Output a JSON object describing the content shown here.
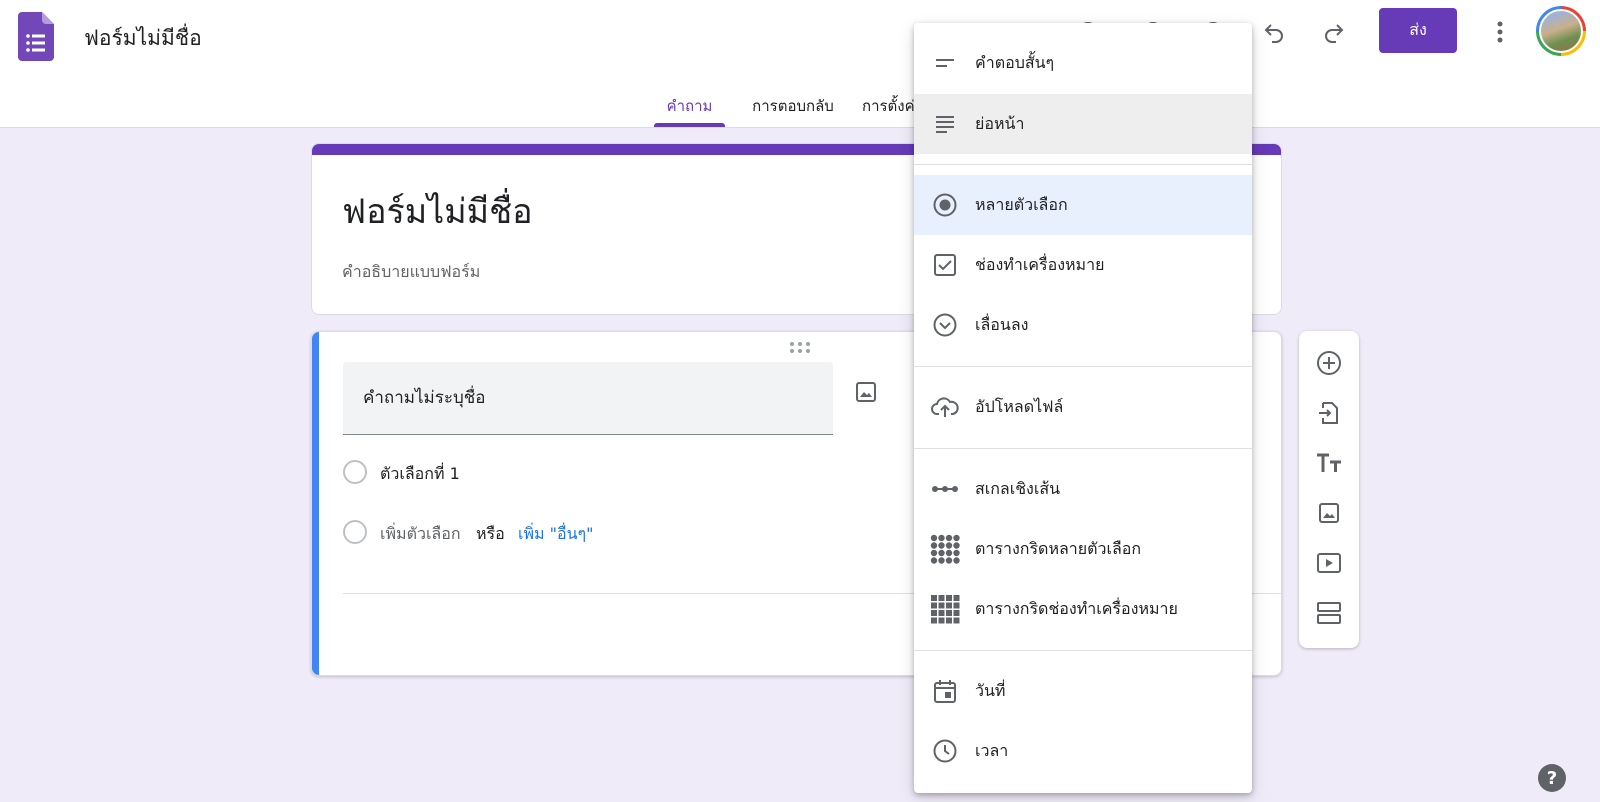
{
  "header": {
    "doc_title": "ฟอร์มไม่มีชื่อ",
    "send_label": "ส่ง"
  },
  "tabs": [
    {
      "label": "คำถาม",
      "active": true
    },
    {
      "label": "การตอบกลับ",
      "active": false
    },
    {
      "label": "การตั้งค่า",
      "active": false
    }
  ],
  "form": {
    "title": "ฟอร์มไม่มีชื่อ",
    "description": "คำอธิบายแบบฟอร์ม"
  },
  "question": {
    "title": "คำถามไม่ระบุชื่อ",
    "option_1": "ตัวเลือกที่ 1",
    "add_option": "เพิ่มตัวเลือก",
    "or": "หรือ",
    "add_other": "เพิ่ม \"อื่นๆ\""
  },
  "question_type_menu": {
    "items": [
      {
        "label": "คำตอบสั้นๆ",
        "icon": "short-answer-icon"
      },
      {
        "label": "ย่อหน้า",
        "icon": "paragraph-icon",
        "state": "hover"
      },
      {
        "label": "หลายตัวเลือก",
        "icon": "radio-icon",
        "state": "selected"
      },
      {
        "label": "ช่องทำเครื่องหมาย",
        "icon": "checkbox-icon"
      },
      {
        "label": "เลื่อนลง",
        "icon": "dropdown-icon"
      },
      {
        "label": "อัปโหลดไฟล์",
        "icon": "upload-icon"
      },
      {
        "label": "สเกลเชิงเส้น",
        "icon": "linear-scale-icon"
      },
      {
        "label": "ตารางกริดหลายตัวเลือก",
        "icon": "multiple-choice-grid-icon"
      },
      {
        "label": "ตารางกริดช่องทำเครื่องหมาย",
        "icon": "checkbox-grid-icon"
      },
      {
        "label": "วันที่",
        "icon": "date-icon"
      },
      {
        "label": "เวลา",
        "icon": "time-icon"
      }
    ]
  },
  "colors": {
    "accent": "#673ab7",
    "background": "#f0ebf8",
    "question_bar": "#4285f4",
    "link": "#1a73e8"
  }
}
